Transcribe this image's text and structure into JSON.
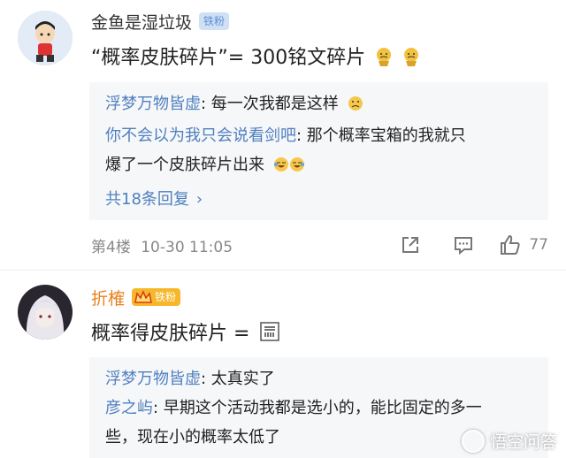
{
  "comments": [
    {
      "author": "金鱼是湿垃圾",
      "badge": "铁粉",
      "text": "“概率皮肤碎片”= 300铭文碎片",
      "replies": [
        {
          "user": "浮梦万物皆虚",
          "text": ": 每一次我都是这样"
        },
        {
          "user": "你不会以为我只会说看剑吧",
          "text": ": 那个概率宝箱的我就只",
          "text2": "爆了一个皮肤碎片出来"
        }
      ],
      "more_replies": "共18条回复",
      "floor": "第4楼",
      "time": "10-30 11:05",
      "likes": "77"
    },
    {
      "author": "折榷",
      "badge": "铁粉",
      "text": "概率得皮肤碎片 = ",
      "replies": [
        {
          "user": "浮梦万物皆虚",
          "text": ": 太真实了"
        },
        {
          "user": "彦之屿",
          "text": ": 早期这个活动我都是选小的，能比固定的多一",
          "text2": "些，现在小的概率太低了"
        }
      ]
    }
  ],
  "watermark": "悟空问答",
  "colors": {
    "link": "#4f7fbf",
    "author_vip": "#e8821e",
    "badge_bg": "#cfe0f5",
    "reply_bg": "#f6f7f9"
  }
}
